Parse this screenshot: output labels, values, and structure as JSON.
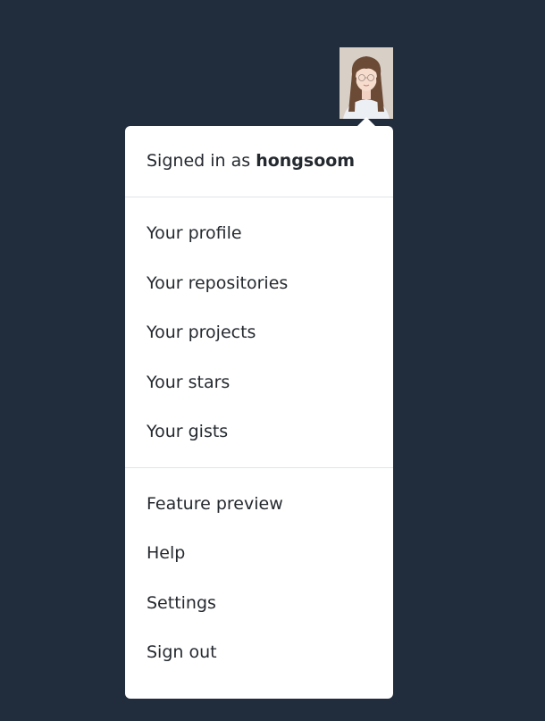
{
  "user": {
    "signed_in_prefix": "Signed in as",
    "username": "hongsoom",
    "avatar_icon": "user-avatar-photo"
  },
  "menu": {
    "section_profile": [
      {
        "label": "Your profile"
      },
      {
        "label": "Your repositories"
      },
      {
        "label": "Your projects"
      },
      {
        "label": "Your stars"
      },
      {
        "label": "Your gists"
      }
    ],
    "section_settings": [
      {
        "label": "Feature preview"
      },
      {
        "label": "Help"
      },
      {
        "label": "Settings"
      },
      {
        "label": "Sign out"
      }
    ]
  },
  "colors": {
    "background": "#212c3d",
    "menu_background": "#ffffff",
    "text": "#24292f",
    "divider": "#e1e4e8"
  }
}
